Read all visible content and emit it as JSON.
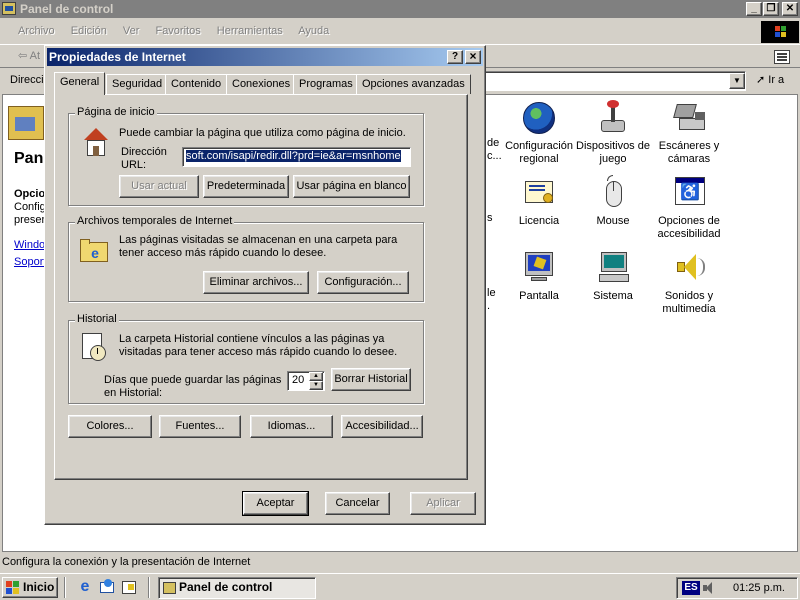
{
  "window": {
    "title": "Panel de control",
    "icon": "control-panel-icon"
  },
  "menu": {
    "items": [
      "Archivo",
      "Edición",
      "Ver",
      "Favoritos",
      "Herramientas",
      "Ayuda"
    ]
  },
  "toolbar": {
    "back_label": "At"
  },
  "address": {
    "label": "Direcci",
    "go_label": "Ir a"
  },
  "left_panel": {
    "title_fragment": "Pan",
    "subtitle_fragment": "Opcio",
    "text_lines": [
      "Config",
      "presen"
    ],
    "links": [
      "Windo",
      "Soport"
    ]
  },
  "cp_items": [
    {
      "label": "Configuración regional",
      "icon": "globe-icon"
    },
    {
      "label": "Dispositivos de juego",
      "icon": "joystick-icon"
    },
    {
      "label": "Escáneres y cámaras",
      "icon": "scanner-icon"
    },
    {
      "label": "Licencia",
      "icon": "certificate-icon"
    },
    {
      "label": "Mouse",
      "icon": "mouse-icon"
    },
    {
      "label": "Opciones de accesibilidad",
      "icon": "accessibility-icon"
    },
    {
      "label": "Pantalla",
      "icon": "monitor-icon"
    },
    {
      "label": "Sistema",
      "icon": "computer-icon"
    },
    {
      "label": "Sonidos y multimedia",
      "icon": "speaker-icon"
    }
  ],
  "partial_labels": [
    "de",
    "c...",
    "s",
    "le",
    "."
  ],
  "status_bar": {
    "text": "Configura la conexión y la presentación de Internet"
  },
  "dialog": {
    "title": "Propiedades de Internet",
    "help_btn": "?",
    "close_btn": "×",
    "tabs": [
      "General",
      "Seguridad",
      "Contenido",
      "Conexiones",
      "Programas",
      "Opciones avanzadas"
    ],
    "home": {
      "legend": "Página de inicio",
      "desc": "Puede cambiar la página que utiliza como página de inicio.",
      "addr_label": "Dirección URL:",
      "addr_value": "soft.com/isapi/redir.dll?prd=ie&ar=msnhome",
      "btn_current": "Usar actual",
      "btn_default": "Predeterminada",
      "btn_blank": "Usar página en blanco"
    },
    "temp": {
      "legend": "Archivos temporales de Internet",
      "desc": "Las páginas visitadas se almacenan en una carpeta para tener acceso más rápido cuando lo desee.",
      "btn_delete": "Eliminar archivos...",
      "btn_settings": "Configuración..."
    },
    "history": {
      "legend": "Historial",
      "desc": "La carpeta Historial contiene vínculos a las páginas ya visitadas para tener acceso más rápido cuando lo desee.",
      "days_label": "Días que puede guardar las páginas en Historial:",
      "days_value": "20",
      "btn_clear": "Borrar Historial"
    },
    "bottom_buttons": [
      "Colores...",
      "Fuentes...",
      "Idiomas...",
      "Accesibilidad..."
    ],
    "btn_ok": "Aceptar",
    "btn_cancel": "Cancelar",
    "btn_apply": "Aplicar"
  },
  "taskbar": {
    "start": "Inicio",
    "task": "Panel de control",
    "lang": "ES",
    "clock": "01:25 p.m."
  }
}
